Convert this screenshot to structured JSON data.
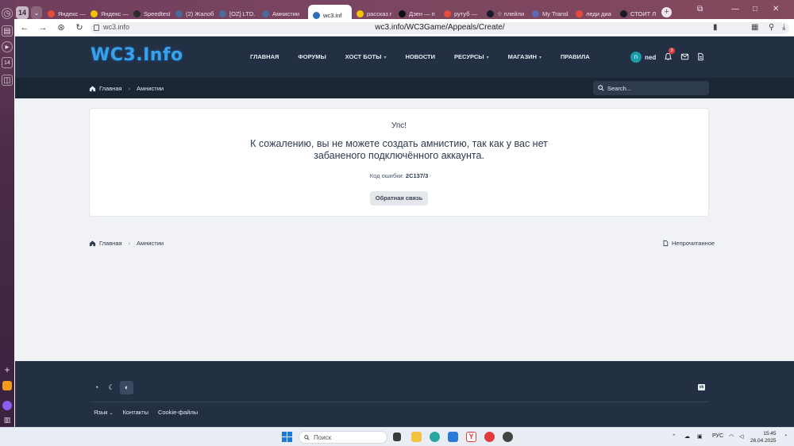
{
  "browser": {
    "tab_counter": "14",
    "tabs": [
      {
        "label": "Яндекс —",
        "color": "#e84a3c"
      },
      {
        "label": "Яндекс —",
        "color": "#f5c400"
      },
      {
        "label": "Speedtest",
        "color": "#2b2b2b"
      },
      {
        "label": "(2) Жалоб",
        "color": "#4b6a9b"
      },
      {
        "label": "[OZ] LTD.",
        "color": "#4b6a9b"
      },
      {
        "label": "Амнистии",
        "color": "#4b6a9b"
      },
      {
        "label": "wc3.inf",
        "color": "#2c6fb5"
      },
      {
        "label": "рассказ г",
        "color": "#f5c400"
      },
      {
        "label": "Дзен — п",
        "color": "#111111"
      },
      {
        "label": "рутуб —",
        "color": "#e84a3c"
      },
      {
        "label": "☆ плейли",
        "color": "#1a1a2e"
      },
      {
        "label": "My Transl",
        "color": "#5a6ab5"
      },
      {
        "label": "леди диа",
        "color": "#e84a3c"
      },
      {
        "label": "СТОИТ Л",
        "color": "#1a1a2e"
      }
    ],
    "address_host": "wc3.info",
    "address_url": "wc3.info/WC3Game/Appeals/Create/"
  },
  "header": {
    "logo": "WC3.Info",
    "nav": [
      {
        "label": "ГЛАВНАЯ",
        "dropdown": false
      },
      {
        "label": "ФОРУМЫ",
        "dropdown": false
      },
      {
        "label": "ХОСТ БОТЫ",
        "dropdown": true
      },
      {
        "label": "НОВОСТИ",
        "dropdown": false
      },
      {
        "label": "РЕСУРСЫ",
        "dropdown": true
      },
      {
        "label": "МАГАЗИН",
        "dropdown": true
      },
      {
        "label": "ПРАВИЛА",
        "dropdown": false
      }
    ],
    "avatar_letter": "n",
    "username": "ned",
    "notification_count": "3"
  },
  "breadcrumb": {
    "home": "Главная",
    "current": "Амнистии"
  },
  "search": {
    "placeholder": "Search..."
  },
  "error_card": {
    "title": "Упс!",
    "message": "К сожалению, вы не можете создать амнистию, так как у вас нет забаненого подключённого аккаунта.",
    "code_label": "Код ошибки:",
    "code_value": "2C137/3",
    "feedback_button": "Обратная связь"
  },
  "bottom_bar": {
    "unread_label": "Непрочитанное"
  },
  "footer": {
    "links": [
      "Язык",
      "Контакты",
      "Cookie-файлы"
    ]
  },
  "taskbar": {
    "search_placeholder": "Поиск",
    "lang": "РУС",
    "time": "15:45",
    "date": "26.04.2025"
  },
  "colors": {
    "header_bg": "#233044",
    "subbar_bg": "#1b2635",
    "accent": "#3aa0e8",
    "badge": "#e23b3b"
  }
}
